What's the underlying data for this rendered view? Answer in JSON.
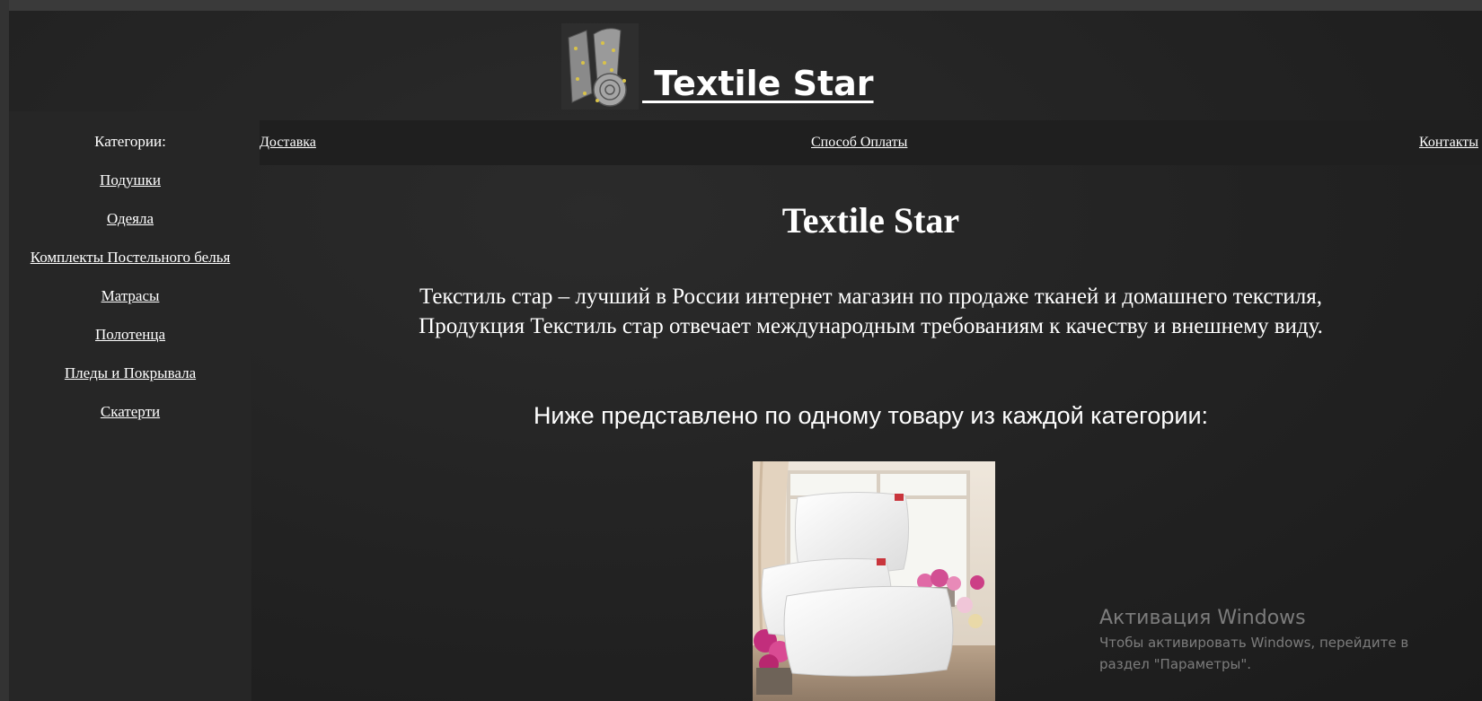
{
  "header": {
    "brand_title": " Textile Star",
    "logo_icon": "fabric-roll-icon"
  },
  "sidebar": {
    "heading": "Категории:",
    "items": [
      {
        "label": "Подушки"
      },
      {
        "label": "Одеяла"
      },
      {
        "label": "Комплекты Постельного белья"
      },
      {
        "label": "Матрасы"
      },
      {
        "label": "Полотенца"
      },
      {
        "label": "Пледы и Покрывала"
      },
      {
        "label": "Скатерти"
      }
    ]
  },
  "nav": {
    "items": [
      {
        "label": "Доставка"
      },
      {
        "label": "Способ Оплаты"
      },
      {
        "label": "Контакты"
      }
    ]
  },
  "main": {
    "title": "Textile Star",
    "intro_line1": "Текстиль стар – лучший в России интернет магазин по продаже тканей и домашнего текстиля,",
    "intro_line2": "Продукция Текстиль стар отвечает международным требованиям к качеству и внешнему виду.",
    "subtitle": "Ниже представлено по одному товару из каждой категории:",
    "product_image": "pillows-photo"
  },
  "os_watermark": {
    "title": "Активация Windows",
    "line1": "Чтобы активировать Windows, перейдите в",
    "line2": "раздел \"Параметры\"."
  },
  "colors": {
    "background": "#222222",
    "sidebar": "#262626",
    "navbar": "#1f1f1f",
    "text": "#ffffff"
  }
}
